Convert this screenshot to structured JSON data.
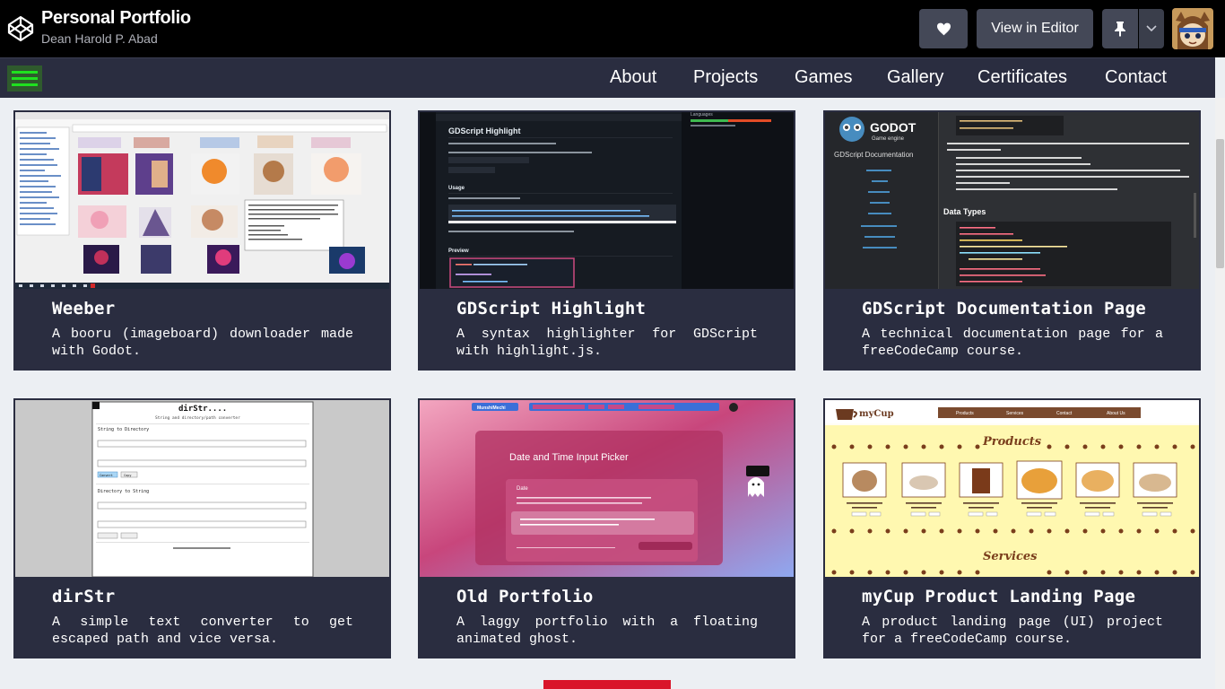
{
  "header": {
    "title": "Personal Portfolio",
    "author": "Dean Harold P. Abad",
    "view_in_editor": "View in Editor",
    "icons": {
      "logo": "codepen-logo-icon",
      "heart": "heart-icon",
      "pin": "pin-icon",
      "caret": "chevron-down-icon"
    }
  },
  "nav": {
    "menu_icon": "hamburger-icon",
    "links": [
      "About",
      "Projects",
      "Games",
      "Gallery",
      "Certificates",
      "Contact"
    ]
  },
  "projects": [
    {
      "title": "Weeber",
      "description": "A booru (imageboard) downloader made with Godot."
    },
    {
      "title": "GDScript Highlight",
      "description": "A syntax highlighter for GDScript with highlight.js."
    },
    {
      "title": "GDScript Documentation Page",
      "description": "A technical documentation page for a freeCodeCamp course."
    },
    {
      "title": "dirStr",
      "description": "A simple text converter to get escaped path and vice versa."
    },
    {
      "title": "Old Portfolio",
      "description": "A laggy portfolio with a floating animated ghost."
    },
    {
      "title": "myCup Product Landing Page",
      "description": "A product landing page (UI) project for a freeCodeCamp course."
    }
  ],
  "thumbnails": {
    "gdscript_highlight": {
      "heading": "GDScript Highlight",
      "section_usage": "Usage",
      "section_preview": "Preview",
      "side_label": "Languages"
    },
    "godot_docs": {
      "logo_text": "GODOT",
      "logo_sub": "Game engine",
      "nav_title": "GDScript Documentation",
      "section": "Data Types"
    },
    "dirstr": {
      "title": "dirStr....",
      "subtitle": "String and directory/path converter",
      "section1": "String to Directory",
      "section2": "Directory to String",
      "btn_convert": "Convert",
      "btn_copy": "Copy"
    },
    "old_portfolio": {
      "heading": "Date and Time Input Picker",
      "card_label": "Date",
      "brand": "MunshiMechi"
    },
    "mycup": {
      "brand": "myCup",
      "section1": "Products",
      "section2": "Services",
      "nav": [
        "Products",
        "Services",
        "Contact",
        "About Us"
      ]
    }
  },
  "colors": {
    "header_bg": "#000000",
    "nav_bg": "#2a2d40",
    "card_bg": "#2a2d40",
    "page_bg": "#eceff3",
    "hamburger": "#1fe11f",
    "accent_red": "#d9152a"
  }
}
